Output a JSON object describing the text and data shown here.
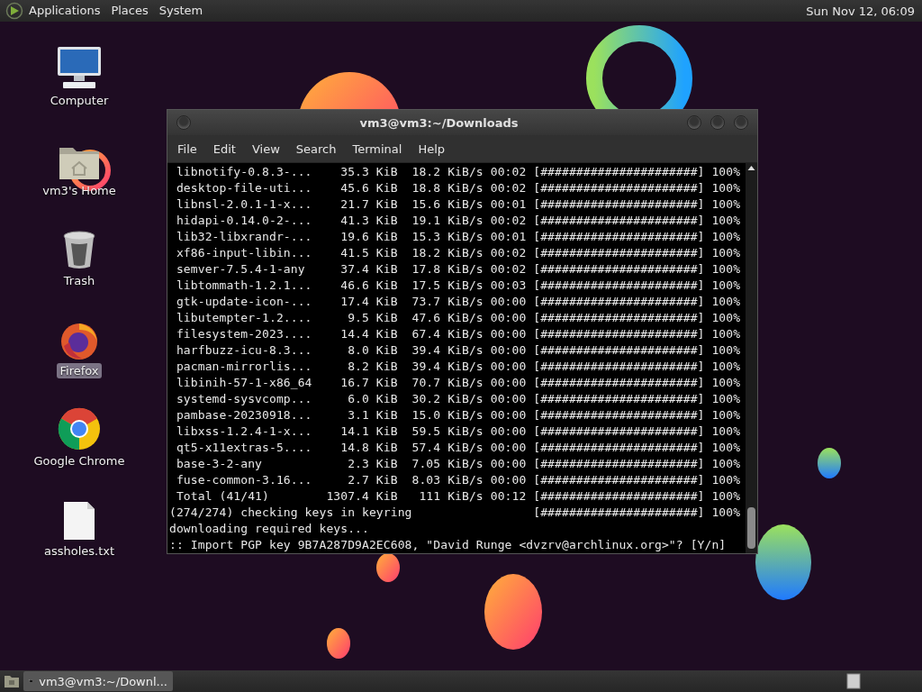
{
  "top_panel": {
    "menus": [
      "Applications",
      "Places",
      "System"
    ],
    "clock": "Sun Nov 12, 06:09"
  },
  "desktop_icons": [
    {
      "kind": "computer",
      "label": "Computer",
      "selected": false
    },
    {
      "kind": "home",
      "label": "vm3's Home",
      "selected": false
    },
    {
      "kind": "trash",
      "label": "Trash",
      "selected": false
    },
    {
      "kind": "firefox",
      "label": "Firefox",
      "selected": true
    },
    {
      "kind": "chrome",
      "label": "Google Chrome",
      "selected": false
    },
    {
      "kind": "file",
      "label": "assholes.txt",
      "selected": false
    }
  ],
  "terminal_window": {
    "title": "vm3@vm3:~/Downloads",
    "menu": [
      "File",
      "Edit",
      "View",
      "Search",
      "Terminal",
      "Help"
    ],
    "lines": [
      " libnotify-0.8.3-...    35.3 KiB  18.2 KiB/s 00:02 [######################] 100%",
      " desktop-file-uti...    45.6 KiB  18.8 KiB/s 00:02 [######################] 100%",
      " libnsl-2.0.1-1-x...    21.7 KiB  15.6 KiB/s 00:01 [######################] 100%",
      " hidapi-0.14.0-2-...    41.3 KiB  19.1 KiB/s 00:02 [######################] 100%",
      " lib32-libxrandr-...    19.6 KiB  15.3 KiB/s 00:01 [######################] 100%",
      " xf86-input-libin...    41.5 KiB  18.2 KiB/s 00:02 [######################] 100%",
      " semver-7.5.4-1-any     37.4 KiB  17.8 KiB/s 00:02 [######################] 100%",
      " libtommath-1.2.1...    46.6 KiB  17.5 KiB/s 00:03 [######################] 100%",
      " gtk-update-icon-...    17.4 KiB  73.7 KiB/s 00:00 [######################] 100%",
      " libutempter-1.2....     9.5 KiB  47.6 KiB/s 00:00 [######################] 100%",
      " filesystem-2023....    14.4 KiB  67.4 KiB/s 00:00 [######################] 100%",
      " harfbuzz-icu-8.3...     8.0 KiB  39.4 KiB/s 00:00 [######################] 100%",
      " pacman-mirrorlis...     8.2 KiB  39.4 KiB/s 00:00 [######################] 100%",
      " libinih-57-1-x86_64    16.7 KiB  70.7 KiB/s 00:00 [######################] 100%",
      " systemd-sysvcomp...     6.0 KiB  30.2 KiB/s 00:00 [######################] 100%",
      " pambase-20230918...     3.1 KiB  15.0 KiB/s 00:00 [######################] 100%",
      " libxss-1.2.4-1-x...    14.1 KiB  59.5 KiB/s 00:00 [######################] 100%",
      " qt5-x11extras-5....    14.8 KiB  57.4 KiB/s 00:00 [######################] 100%",
      " base-3-2-any            2.3 KiB  7.05 KiB/s 00:00 [######################] 100%",
      " fuse-common-3.16...     2.7 KiB  8.03 KiB/s 00:00 [######################] 100%",
      " Total (41/41)        1307.4 KiB   111 KiB/s 00:12 [######################] 100%",
      "(274/274) checking keys in keyring                 [######################] 100%",
      "downloading required keys...",
      ":: Import PGP key 9B7A287D9A2EC608, \"David Runge <dvzrv@archlinux.org>\"? [Y/n]"
    ]
  },
  "bottom_panel": {
    "tasks": [
      {
        "label": "vm3@vm3:~/Downl...",
        "selected": true
      }
    ]
  }
}
